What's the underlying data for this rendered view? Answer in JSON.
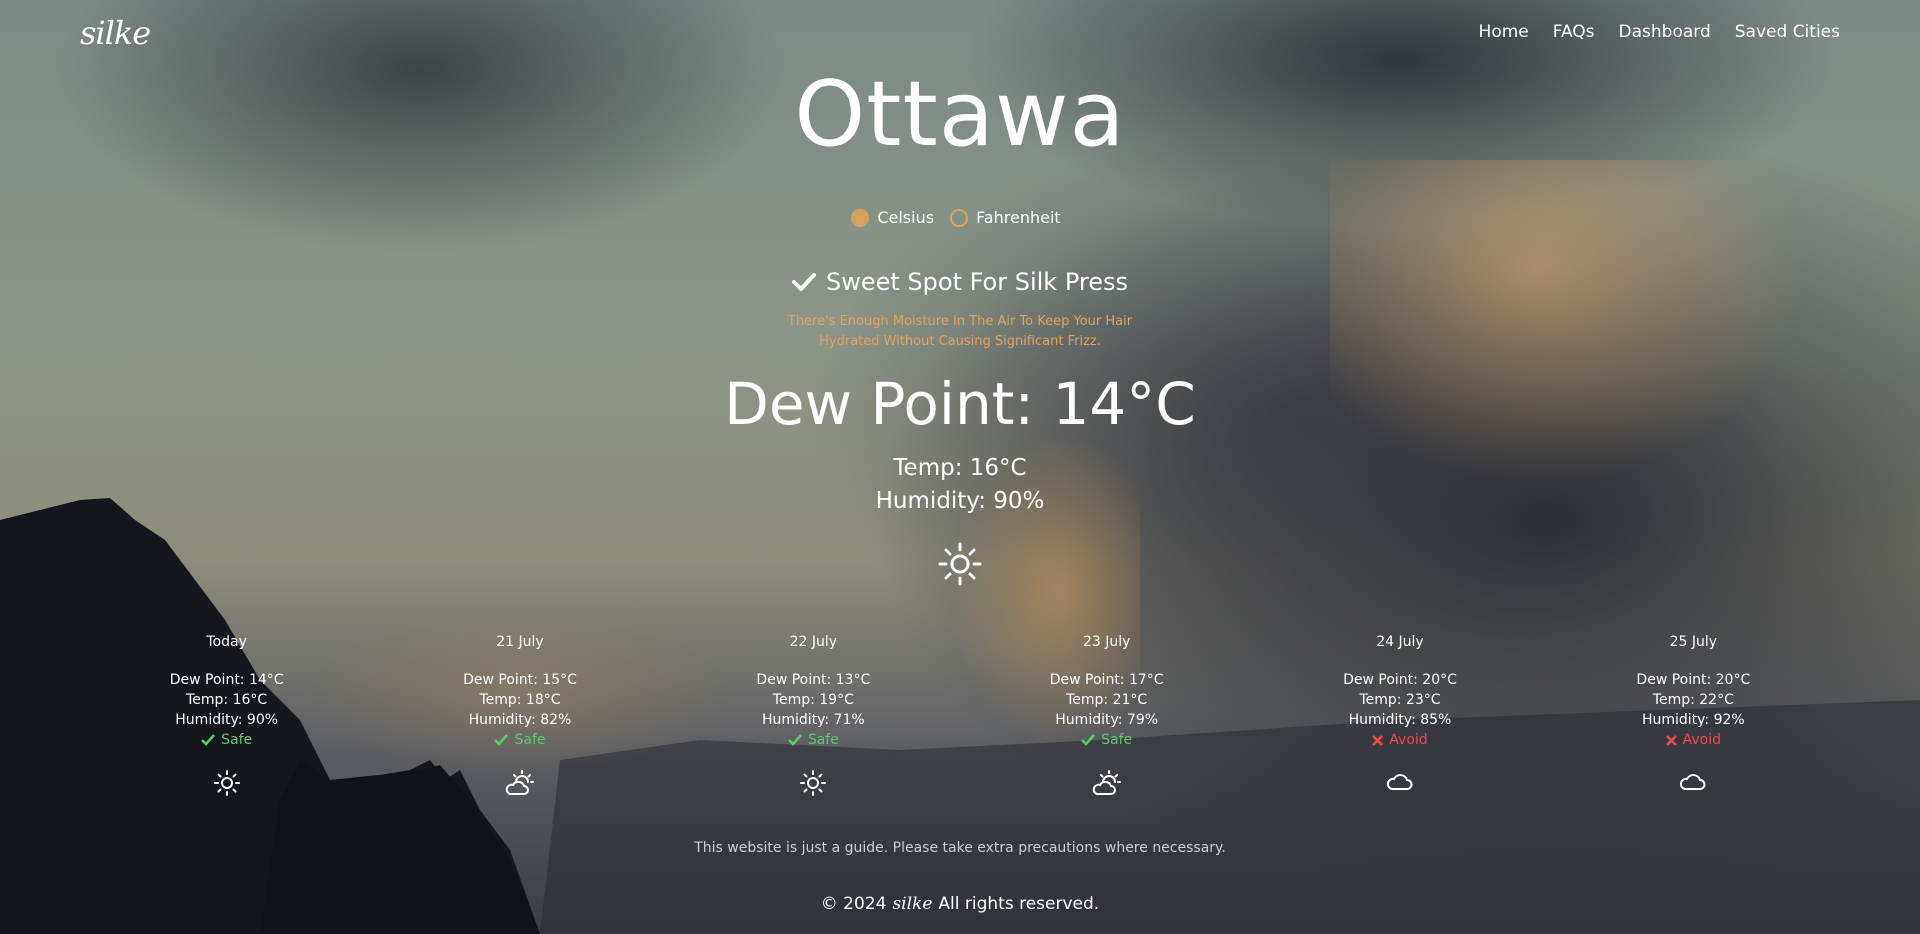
{
  "header": {
    "logo": "silke",
    "nav": [
      "Home",
      "FAQs",
      "Dashboard",
      "Saved Cities"
    ]
  },
  "city": "Ottawa",
  "units": {
    "selected": "Celsius",
    "options": [
      "Celsius",
      "Fahrenheit"
    ]
  },
  "verdict": {
    "title": "Sweet Spot For Silk Press",
    "advice_line1": "There's Enough Moisture In The Air To Keep Your Hair",
    "advice_line2": "Hydrated Without Causing Significant Frizz."
  },
  "current": {
    "dew_point": "Dew Point: 14°C",
    "temp": "Temp: 16°C",
    "humidity": "Humidity: 90%",
    "icon": "sun-icon"
  },
  "forecast": [
    {
      "date": "Today",
      "dew": "Dew Point: 14°C",
      "temp": "Temp: 16°C",
      "hum": "Humidity: 90%",
      "status": "Safe",
      "icon": "sun-icon"
    },
    {
      "date": "21 July",
      "dew": "Dew Point: 15°C",
      "temp": "Temp: 18°C",
      "hum": "Humidity: 82%",
      "status": "Safe",
      "icon": "partly-cloudy-icon"
    },
    {
      "date": "22 July",
      "dew": "Dew Point: 13°C",
      "temp": "Temp: 19°C",
      "hum": "Humidity: 71%",
      "status": "Safe",
      "icon": "sun-icon"
    },
    {
      "date": "23 July",
      "dew": "Dew Point: 17°C",
      "temp": "Temp: 21°C",
      "hum": "Humidity: 79%",
      "status": "Safe",
      "icon": "partly-cloudy-icon"
    },
    {
      "date": "24 July",
      "dew": "Dew Point: 20°C",
      "temp": "Temp: 23°C",
      "hum": "Humidity: 85%",
      "status": "Avoid",
      "icon": "cloud-icon"
    },
    {
      "date": "25 July",
      "dew": "Dew Point: 20°C",
      "temp": "Temp: 22°C",
      "hum": "Humidity: 92%",
      "status": "Avoid",
      "icon": "cloud-icon"
    }
  ],
  "footer": {
    "disclaimer": "This website is just a guide. Please take extra precautions where necessary.",
    "copyright_prefix": "© 2024",
    "brand": "silke",
    "copyright_suffix": "All rights reserved."
  },
  "colors": {
    "accent": "#d7a35c",
    "safe": "#5ecb6a",
    "avoid": "#ef4b4b",
    "advice": "#e0a45a"
  }
}
